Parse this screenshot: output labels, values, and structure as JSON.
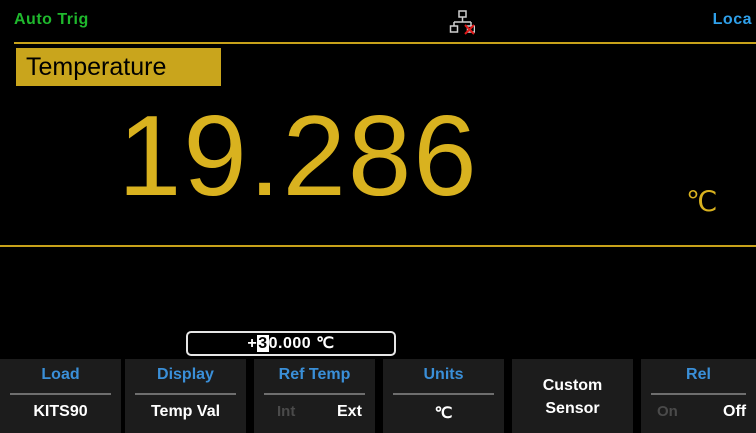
{
  "status": {
    "trigger": "Auto Trig",
    "remote": "Loca",
    "lan_icon": "network-disconnected-icon",
    "trigger_color": "#1fb82d",
    "remote_color": "#2fa0ea"
  },
  "measurement": {
    "function": "Temperature",
    "value": "19.286",
    "unit": "℃",
    "accent_color": "#d9b21f"
  },
  "edit": {
    "prefix": "+",
    "cursor_digit": "3",
    "rest": "0.000 ℃"
  },
  "softkeys": [
    {
      "title": "Load",
      "value": "KITS90"
    },
    {
      "title": "Display",
      "value": "Temp Val"
    },
    {
      "title": "Ref Temp",
      "opt_a": "Int",
      "opt_b": "Ext"
    },
    {
      "title": "Units",
      "value": "℃"
    },
    {
      "line1": "Custom",
      "line2": "Sensor"
    },
    {
      "title": "Rel",
      "opt_a": "On",
      "opt_b": "Off"
    }
  ]
}
